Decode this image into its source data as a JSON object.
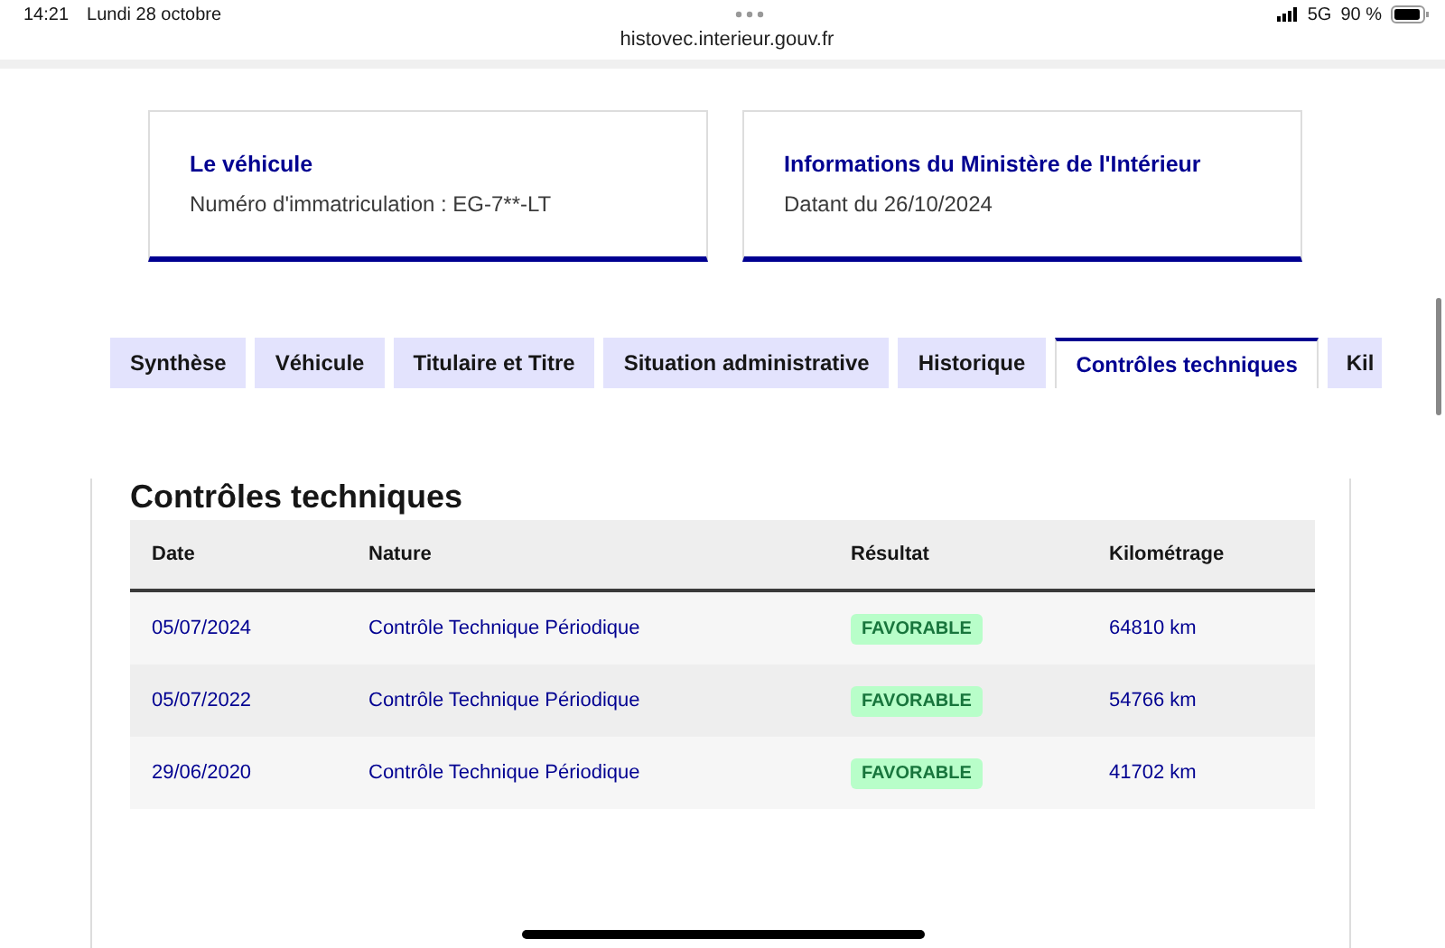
{
  "status_bar": {
    "time": "14:21",
    "date": "Lundi 28 octobre",
    "url": "histovec.interieur.gouv.fr",
    "network": "5G",
    "battery": "90 %"
  },
  "cards": [
    {
      "title": "Le véhicule",
      "text": "Numéro d'immatriculation : EG-7**-LT"
    },
    {
      "title": "Informations du Ministère de l'Intérieur",
      "text": "Datant du 26/10/2024"
    }
  ],
  "tabs": [
    {
      "label": "Synthèse",
      "selected": false
    },
    {
      "label": "Véhicule",
      "selected": false
    },
    {
      "label": "Titulaire et Titre",
      "selected": false
    },
    {
      "label": "Situation administrative",
      "selected": false
    },
    {
      "label": "Historique",
      "selected": false
    },
    {
      "label": "Contrôles techniques",
      "selected": true
    },
    {
      "label": "Kil",
      "selected": false
    }
  ],
  "section_title": "Contrôles techniques",
  "table": {
    "columns": [
      "Date",
      "Nature",
      "Résultat",
      "Kilométrage"
    ],
    "rows": [
      [
        "05/07/2024",
        "Contrôle Technique Périodique",
        "FAVORABLE",
        "64810 km"
      ],
      [
        "05/07/2022",
        "Contrôle Technique Périodique",
        "FAVORABLE",
        "54766 km"
      ],
      [
        "29/06/2020",
        "Contrôle Technique Périodique",
        "FAVORABLE",
        "41702 km"
      ]
    ]
  }
}
